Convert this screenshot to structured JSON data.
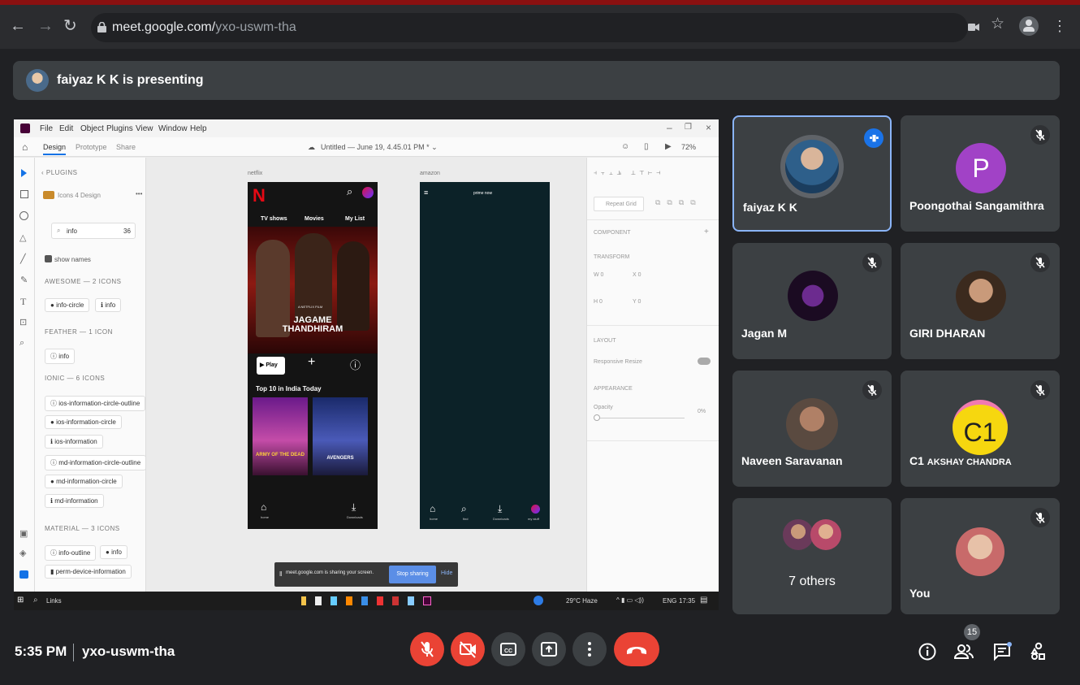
{
  "browser": {
    "url_host": "meet.google.com/",
    "url_path": "yxo-uswm-tha",
    "icons": [
      "back-arrow-icon",
      "forward-arrow-icon",
      "reload-icon",
      "lock-icon",
      "camera-icon",
      "star-icon",
      "profile-icon",
      "more-vert-icon"
    ]
  },
  "banner": {
    "text": "faiyaz K K is presenting"
  },
  "xd": {
    "menu": [
      "File",
      "Edit",
      "Object",
      "Plugins",
      "View",
      "Window",
      "Help"
    ],
    "tabs": {
      "design": "Design",
      "prototype": "Prototype",
      "share": "Share"
    },
    "doc_title": "Untitled — June 19, 4.45.01 PM * ⌄",
    "zoom": "72%",
    "plugins_label": "‹ PLUGINS",
    "plugin_name": "Icons 4 Design",
    "search_value": "info",
    "search_size": "36",
    "show_names": "show names",
    "sections": {
      "awesome": "AWESOME — 2 ICONS",
      "feather": "FEATHER — 1 ICON",
      "ionic": "IONIC — 6 ICONS",
      "material": "MATERIAL — 3 ICONS"
    },
    "icons": {
      "aw1": "info-circle",
      "aw2": "info",
      "fe1": "info",
      "io1": "ios-information-circle-outline",
      "io2": "ios-information-circle",
      "io3": "ios-information",
      "io4": "md-information-circle-outline",
      "io5": "md-information-circle",
      "io6": "md-information",
      "ma1": "info-outline",
      "ma2": "info",
      "ma3": "perm-device-information"
    },
    "artboards": {
      "left": "netflix",
      "right": "amazon"
    },
    "netflix": {
      "nav": [
        "TV shows",
        "Movies",
        "My List"
      ],
      "poster_tag": "A NETFLIX FILM",
      "poster_title": "JAGAME THANDHIRAM",
      "play": "Play",
      "row_title": "Top 10 in India Today",
      "tile1": "ARMY OF THE DEAD",
      "tile2": "AVENGERS",
      "tabs": [
        "home",
        "Downloads"
      ]
    },
    "amazon": {
      "logo": "prime now",
      "tabs": [
        "home",
        "find",
        "Downloads",
        "my stuff"
      ]
    },
    "props": {
      "repeat_grid": "Repeat Grid",
      "component": "COMPONENT",
      "transform": "TRANSFORM",
      "w": "W 0",
      "x": "X 0",
      "h": "H 0",
      "y": "Y 0",
      "layout": "LAYOUT",
      "responsive": "Responsive Resize",
      "appearance": "APPEARANCE",
      "opacity": "Opacity",
      "opacity_val": "0%"
    },
    "share_notice": "meet.google.com is sharing your screen.",
    "stop_sharing": "Stop sharing",
    "hide": "Hide",
    "taskbar": {
      "search": "Links",
      "weather": "29°C Haze",
      "lang": "ENG",
      "time": "17:35"
    }
  },
  "participants": [
    {
      "name": "faiyaz K K",
      "speaking": true
    },
    {
      "name": "Poongothai Sangamithra",
      "letter": "P",
      "color": "#a142c6"
    },
    {
      "name": "Jagan M"
    },
    {
      "name": "GIRI DHARAN"
    },
    {
      "name": "Naveen Saravanan"
    },
    {
      "name_big": "C1",
      "name_rest": "AKSHAY CHANDRA",
      "letter": "C1",
      "color": "#f6d70f"
    },
    {
      "name": "7 others"
    },
    {
      "name": "You"
    }
  ],
  "meeting": {
    "time": "5:35 PM",
    "code": "yxo-uswm-tha",
    "participant_count": "15"
  },
  "colors": {
    "accent_blue": "#8ab4f8",
    "red": "#ea4335",
    "tile": "#3c4043"
  }
}
